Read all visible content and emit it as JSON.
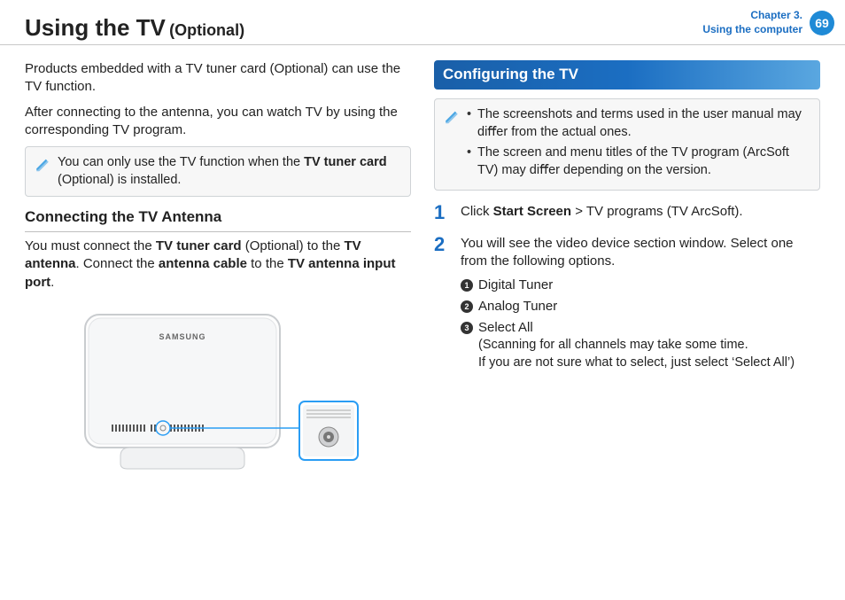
{
  "header": {
    "title": "Using the TV",
    "subtitle": "(Optional)",
    "chapter_label": "Chapter 3.",
    "chapter_name": "Using the computer",
    "page_number": "69"
  },
  "left": {
    "intro1": "Products embedded with a TV tuner card (Optional) can use the TV function.",
    "intro2": "After connecting to the antenna, you can watch TV by using the corresponding TV program.",
    "note_prefix": "You can only use the TV function when the ",
    "note_bold": "TV tuner card",
    "note_suffix": " (Optional) is installed.",
    "subhead": "Connecting the TV Antenna",
    "antenna_p1": "You must connect the ",
    "antenna_b1": "TV tuner card",
    "antenna_p2": " (Optional) to the ",
    "antenna_b2": "TV antenna",
    "antenna_p3": ". Connect the ",
    "antenna_b3": "antenna cable",
    "antenna_p4": " to the ",
    "antenna_b4": "TV antenna input port",
    "antenna_p5": ".",
    "device_label": "SAMSUNG"
  },
  "right": {
    "section_title": "Conﬁguring the TV",
    "note_items": [
      "The screenshots and terms used in the user manual may diﬀer from the actual ones.",
      "The screen and menu titles of the TV program (ArcSoft TV) may diﬀer depending on the version."
    ],
    "steps": [
      {
        "num": "1",
        "pre": "Click ",
        "b1": "Start Screen",
        "post": " > TV programs (TV ArcSoft)."
      },
      {
        "num": "2",
        "text": "You will see the video device section window. Select one from the following options.",
        "options": [
          {
            "marker": "1",
            "label": "Digital Tuner",
            "note": ""
          },
          {
            "marker": "2",
            "label": "Analog Tuner",
            "note": ""
          },
          {
            "marker": "3",
            "label": "Select All",
            "note": "(Scanning for all channels may take some time.\nIf you are not sure what to select, just select ‘Select All’)"
          }
        ]
      }
    ]
  }
}
